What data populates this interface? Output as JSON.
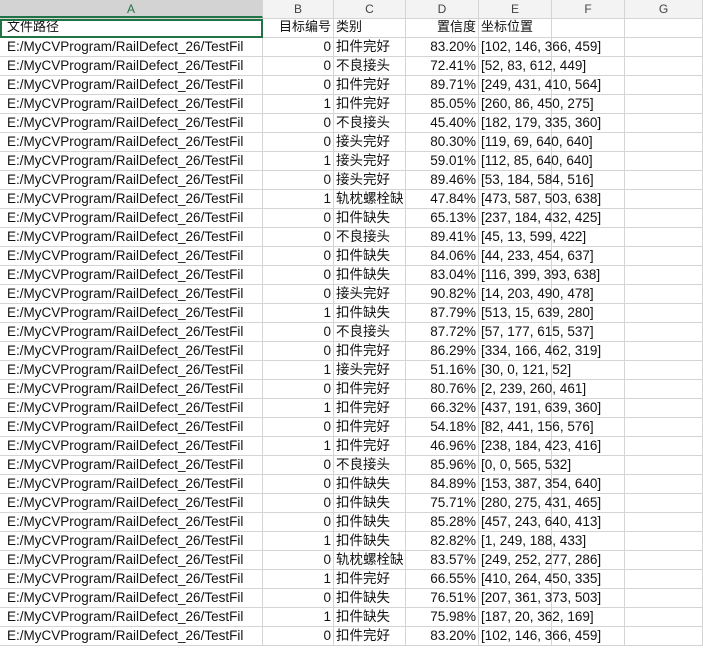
{
  "columns": [
    "A",
    "B",
    "C",
    "D",
    "E",
    "F",
    "G"
  ],
  "header": [
    "文件路径",
    "目标编号",
    "类别",
    "置信度",
    "坐标位置"
  ],
  "rows": [
    [
      "E:/MyCVProgram/RailDefect_26/TestFil",
      "0",
      "扣件完好",
      "83.20%",
      "[102, 146, 366, 459]"
    ],
    [
      "E:/MyCVProgram/RailDefect_26/TestFil",
      "0",
      "不良接头",
      "72.41%",
      "[52, 83, 612, 449]"
    ],
    [
      "E:/MyCVProgram/RailDefect_26/TestFil",
      "0",
      "扣件完好",
      "89.71%",
      "[249, 431, 410, 564]"
    ],
    [
      "E:/MyCVProgram/RailDefect_26/TestFil",
      "1",
      "扣件完好",
      "85.05%",
      "[260, 86, 450, 275]"
    ],
    [
      "E:/MyCVProgram/RailDefect_26/TestFil",
      "0",
      "不良接头",
      "45.40%",
      "[182, 179, 335, 360]"
    ],
    [
      "E:/MyCVProgram/RailDefect_26/TestFil",
      "0",
      "接头完好",
      "80.30%",
      "[119, 69, 640, 640]"
    ],
    [
      "E:/MyCVProgram/RailDefect_26/TestFil",
      "1",
      "接头完好",
      "59.01%",
      "[112, 85, 640, 640]"
    ],
    [
      "E:/MyCVProgram/RailDefect_26/TestFil",
      "0",
      "接头完好",
      "89.46%",
      "[53, 184, 584, 516]"
    ],
    [
      "E:/MyCVProgram/RailDefect_26/TestFil",
      "1",
      "轨枕螺栓缺",
      "47.84%",
      "[473, 587, 503, 638]"
    ],
    [
      "E:/MyCVProgram/RailDefect_26/TestFil",
      "0",
      "扣件缺失",
      "65.13%",
      "[237, 184, 432, 425]"
    ],
    [
      "E:/MyCVProgram/RailDefect_26/TestFil",
      "0",
      "不良接头",
      "89.41%",
      "[45, 13, 599, 422]"
    ],
    [
      "E:/MyCVProgram/RailDefect_26/TestFil",
      "0",
      "扣件缺失",
      "84.06%",
      "[44, 233, 454, 637]"
    ],
    [
      "E:/MyCVProgram/RailDefect_26/TestFil",
      "0",
      "扣件缺失",
      "83.04%",
      "[116, 399, 393, 638]"
    ],
    [
      "E:/MyCVProgram/RailDefect_26/TestFil",
      "0",
      "接头完好",
      "90.82%",
      "[14, 203, 490, 478]"
    ],
    [
      "E:/MyCVProgram/RailDefect_26/TestFil",
      "1",
      "扣件缺失",
      "87.79%",
      "[513, 15, 639, 280]"
    ],
    [
      "E:/MyCVProgram/RailDefect_26/TestFil",
      "0",
      "不良接头",
      "87.72%",
      "[57, 177, 615, 537]"
    ],
    [
      "E:/MyCVProgram/RailDefect_26/TestFil",
      "0",
      "扣件完好",
      "86.29%",
      "[334, 166, 462, 319]"
    ],
    [
      "E:/MyCVProgram/RailDefect_26/TestFil",
      "1",
      "接头完好",
      "51.16%",
      "[30, 0, 121, 52]"
    ],
    [
      "E:/MyCVProgram/RailDefect_26/TestFil",
      "0",
      "扣件完好",
      "80.76%",
      "[2, 239, 260, 461]"
    ],
    [
      "E:/MyCVProgram/RailDefect_26/TestFil",
      "1",
      "扣件完好",
      "66.32%",
      "[437, 191, 639, 360]"
    ],
    [
      "E:/MyCVProgram/RailDefect_26/TestFil",
      "0",
      "扣件完好",
      "54.18%",
      "[82, 441, 156, 576]"
    ],
    [
      "E:/MyCVProgram/RailDefect_26/TestFil",
      "1",
      "扣件完好",
      "46.96%",
      "[238, 184, 423, 416]"
    ],
    [
      "E:/MyCVProgram/RailDefect_26/TestFil",
      "0",
      "不良接头",
      "85.96%",
      "[0, 0, 565, 532]"
    ],
    [
      "E:/MyCVProgram/RailDefect_26/TestFil",
      "0",
      "扣件缺失",
      "84.89%",
      "[153, 387, 354, 640]"
    ],
    [
      "E:/MyCVProgram/RailDefect_26/TestFil",
      "0",
      "扣件缺失",
      "75.71%",
      "[280, 275, 431, 465]"
    ],
    [
      "E:/MyCVProgram/RailDefect_26/TestFil",
      "0",
      "扣件缺失",
      "85.28%",
      "[457, 243, 640, 413]"
    ],
    [
      "E:/MyCVProgram/RailDefect_26/TestFil",
      "1",
      "扣件缺失",
      "82.82%",
      "[1, 249, 188, 433]"
    ],
    [
      "E:/MyCVProgram/RailDefect_26/TestFil",
      "0",
      "轨枕螺栓缺",
      "83.57%",
      "[249, 252, 277, 286]"
    ],
    [
      "E:/MyCVProgram/RailDefect_26/TestFil",
      "1",
      "扣件完好",
      "66.55%",
      "[410, 264, 450, 335]"
    ],
    [
      "E:/MyCVProgram/RailDefect_26/TestFil",
      "0",
      "扣件缺失",
      "76.51%",
      "[207, 361, 373, 503]"
    ],
    [
      "E:/MyCVProgram/RailDefect_26/TestFil",
      "1",
      "扣件缺失",
      "75.98%",
      "[187, 20, 362, 169]"
    ],
    [
      "E:/MyCVProgram/RailDefect_26/TestFil",
      "0",
      "扣件完好",
      "83.20%",
      "[102, 146, 366, 459]"
    ]
  ],
  "selection": {
    "active_column": "A",
    "active_cell": "A1"
  },
  "colors": {
    "accent": "#217346",
    "grid": "#d4d4d4",
    "header_bg": "#f3f3f3"
  }
}
